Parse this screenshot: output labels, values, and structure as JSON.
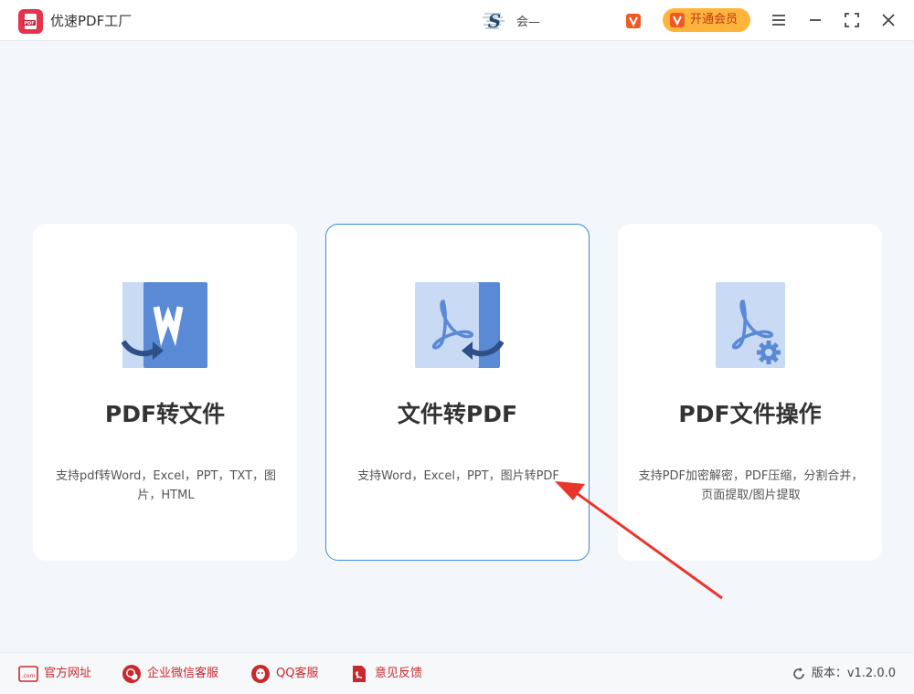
{
  "app": {
    "title": "优速PDF工厂",
    "icon": "pdf-logo-icon"
  },
  "header": {
    "user_name": "会—",
    "vip_button": "开通会员"
  },
  "cards": [
    {
      "title": "PDF转文件",
      "desc": "支持pdf转Word，Excel，PPT，TXT，图片，HTML",
      "icon": "pdf-to-word-icon"
    },
    {
      "title": "文件转PDF",
      "desc": "支持Word，Excel，PPT，图片转PDF",
      "icon": "file-to-pdf-icon"
    },
    {
      "title": "PDF文件操作",
      "desc": "支持PDF加密解密，PDF压缩，分割合并，页面提取/图片提取",
      "icon": "pdf-settings-icon"
    }
  ],
  "footer": {
    "links": [
      {
        "label": "官方网址",
        "icon": "website-icon"
      },
      {
        "label": "企业微信客服",
        "icon": "wechat-icon"
      },
      {
        "label": "QQ客服",
        "icon": "qq-icon"
      },
      {
        "label": "意见反馈",
        "icon": "feedback-icon"
      }
    ],
    "version": "版本：v1.2.0.0"
  },
  "colors": {
    "accent": "#3b8bd9",
    "brand": "#e6334d",
    "icon_blue": "#5a8ad6",
    "icon_light": "#c9daf5",
    "footer_red": "#c9282d"
  }
}
